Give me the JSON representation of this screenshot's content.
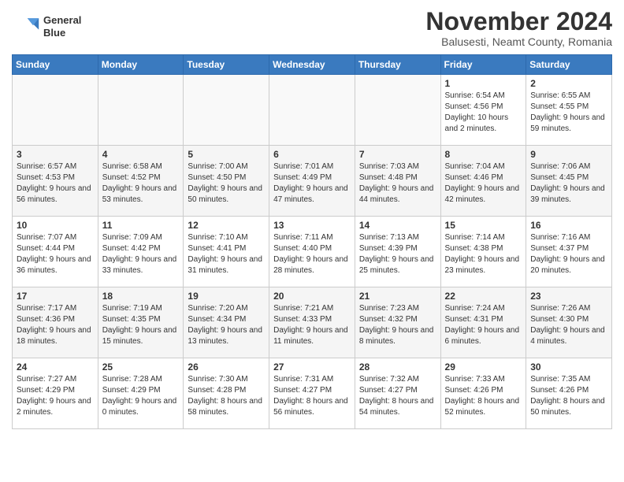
{
  "header": {
    "logo_line1": "General",
    "logo_line2": "Blue",
    "title": "November 2024",
    "subtitle": "Balusesti, Neamt County, Romania"
  },
  "weekdays": [
    "Sunday",
    "Monday",
    "Tuesday",
    "Wednesday",
    "Thursday",
    "Friday",
    "Saturday"
  ],
  "weeks": [
    [
      {
        "day": "",
        "sunrise": "",
        "sunset": "",
        "daylight": ""
      },
      {
        "day": "",
        "sunrise": "",
        "sunset": "",
        "daylight": ""
      },
      {
        "day": "",
        "sunrise": "",
        "sunset": "",
        "daylight": ""
      },
      {
        "day": "",
        "sunrise": "",
        "sunset": "",
        "daylight": ""
      },
      {
        "day": "",
        "sunrise": "",
        "sunset": "",
        "daylight": ""
      },
      {
        "day": "1",
        "sunrise": "Sunrise: 6:54 AM",
        "sunset": "Sunset: 4:56 PM",
        "daylight": "Daylight: 10 hours and 2 minutes."
      },
      {
        "day": "2",
        "sunrise": "Sunrise: 6:55 AM",
        "sunset": "Sunset: 4:55 PM",
        "daylight": "Daylight: 9 hours and 59 minutes."
      }
    ],
    [
      {
        "day": "3",
        "sunrise": "Sunrise: 6:57 AM",
        "sunset": "Sunset: 4:53 PM",
        "daylight": "Daylight: 9 hours and 56 minutes."
      },
      {
        "day": "4",
        "sunrise": "Sunrise: 6:58 AM",
        "sunset": "Sunset: 4:52 PM",
        "daylight": "Daylight: 9 hours and 53 minutes."
      },
      {
        "day": "5",
        "sunrise": "Sunrise: 7:00 AM",
        "sunset": "Sunset: 4:50 PM",
        "daylight": "Daylight: 9 hours and 50 minutes."
      },
      {
        "day": "6",
        "sunrise": "Sunrise: 7:01 AM",
        "sunset": "Sunset: 4:49 PM",
        "daylight": "Daylight: 9 hours and 47 minutes."
      },
      {
        "day": "7",
        "sunrise": "Sunrise: 7:03 AM",
        "sunset": "Sunset: 4:48 PM",
        "daylight": "Daylight: 9 hours and 44 minutes."
      },
      {
        "day": "8",
        "sunrise": "Sunrise: 7:04 AM",
        "sunset": "Sunset: 4:46 PM",
        "daylight": "Daylight: 9 hours and 42 minutes."
      },
      {
        "day": "9",
        "sunrise": "Sunrise: 7:06 AM",
        "sunset": "Sunset: 4:45 PM",
        "daylight": "Daylight: 9 hours and 39 minutes."
      }
    ],
    [
      {
        "day": "10",
        "sunrise": "Sunrise: 7:07 AM",
        "sunset": "Sunset: 4:44 PM",
        "daylight": "Daylight: 9 hours and 36 minutes."
      },
      {
        "day": "11",
        "sunrise": "Sunrise: 7:09 AM",
        "sunset": "Sunset: 4:42 PM",
        "daylight": "Daylight: 9 hours and 33 minutes."
      },
      {
        "day": "12",
        "sunrise": "Sunrise: 7:10 AM",
        "sunset": "Sunset: 4:41 PM",
        "daylight": "Daylight: 9 hours and 31 minutes."
      },
      {
        "day": "13",
        "sunrise": "Sunrise: 7:11 AM",
        "sunset": "Sunset: 4:40 PM",
        "daylight": "Daylight: 9 hours and 28 minutes."
      },
      {
        "day": "14",
        "sunrise": "Sunrise: 7:13 AM",
        "sunset": "Sunset: 4:39 PM",
        "daylight": "Daylight: 9 hours and 25 minutes."
      },
      {
        "day": "15",
        "sunrise": "Sunrise: 7:14 AM",
        "sunset": "Sunset: 4:38 PM",
        "daylight": "Daylight: 9 hours and 23 minutes."
      },
      {
        "day": "16",
        "sunrise": "Sunrise: 7:16 AM",
        "sunset": "Sunset: 4:37 PM",
        "daylight": "Daylight: 9 hours and 20 minutes."
      }
    ],
    [
      {
        "day": "17",
        "sunrise": "Sunrise: 7:17 AM",
        "sunset": "Sunset: 4:36 PM",
        "daylight": "Daylight: 9 hours and 18 minutes."
      },
      {
        "day": "18",
        "sunrise": "Sunrise: 7:19 AM",
        "sunset": "Sunset: 4:35 PM",
        "daylight": "Daylight: 9 hours and 15 minutes."
      },
      {
        "day": "19",
        "sunrise": "Sunrise: 7:20 AM",
        "sunset": "Sunset: 4:34 PM",
        "daylight": "Daylight: 9 hours and 13 minutes."
      },
      {
        "day": "20",
        "sunrise": "Sunrise: 7:21 AM",
        "sunset": "Sunset: 4:33 PM",
        "daylight": "Daylight: 9 hours and 11 minutes."
      },
      {
        "day": "21",
        "sunrise": "Sunrise: 7:23 AM",
        "sunset": "Sunset: 4:32 PM",
        "daylight": "Daylight: 9 hours and 8 minutes."
      },
      {
        "day": "22",
        "sunrise": "Sunrise: 7:24 AM",
        "sunset": "Sunset: 4:31 PM",
        "daylight": "Daylight: 9 hours and 6 minutes."
      },
      {
        "day": "23",
        "sunrise": "Sunrise: 7:26 AM",
        "sunset": "Sunset: 4:30 PM",
        "daylight": "Daylight: 9 hours and 4 minutes."
      }
    ],
    [
      {
        "day": "24",
        "sunrise": "Sunrise: 7:27 AM",
        "sunset": "Sunset: 4:29 PM",
        "daylight": "Daylight: 9 hours and 2 minutes."
      },
      {
        "day": "25",
        "sunrise": "Sunrise: 7:28 AM",
        "sunset": "Sunset: 4:29 PM",
        "daylight": "Daylight: 9 hours and 0 minutes."
      },
      {
        "day": "26",
        "sunrise": "Sunrise: 7:30 AM",
        "sunset": "Sunset: 4:28 PM",
        "daylight": "Daylight: 8 hours and 58 minutes."
      },
      {
        "day": "27",
        "sunrise": "Sunrise: 7:31 AM",
        "sunset": "Sunset: 4:27 PM",
        "daylight": "Daylight: 8 hours and 56 minutes."
      },
      {
        "day": "28",
        "sunrise": "Sunrise: 7:32 AM",
        "sunset": "Sunset: 4:27 PM",
        "daylight": "Daylight: 8 hours and 54 minutes."
      },
      {
        "day": "29",
        "sunrise": "Sunrise: 7:33 AM",
        "sunset": "Sunset: 4:26 PM",
        "daylight": "Daylight: 8 hours and 52 minutes."
      },
      {
        "day": "30",
        "sunrise": "Sunrise: 7:35 AM",
        "sunset": "Sunset: 4:26 PM",
        "daylight": "Daylight: 8 hours and 50 minutes."
      }
    ]
  ]
}
